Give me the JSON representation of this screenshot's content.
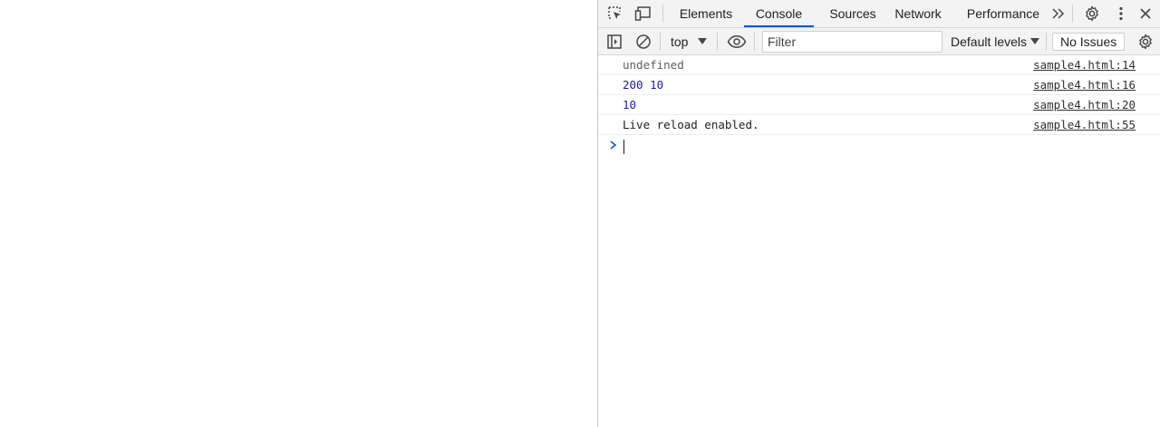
{
  "devtools": {
    "tabs": [
      {
        "label": "Elements",
        "active": false
      },
      {
        "label": "Console",
        "active": true
      },
      {
        "label": "Sources",
        "active": false
      },
      {
        "label": "Network",
        "active": false
      },
      {
        "label": "Performance",
        "active": false
      }
    ],
    "icons": {
      "inspect": "inspect-element-icon",
      "device": "device-toolbar-icon",
      "more_tabs": "chevron-double-right-icon",
      "settings": "gear-icon",
      "menu": "kebab-menu-icon",
      "close": "close-icon"
    },
    "accent_color": "#0b57d0"
  },
  "console_toolbar": {
    "context": "top",
    "filter_placeholder": "Filter",
    "filter_value": "",
    "levels_label": "Default levels",
    "issues_label": "No Issues"
  },
  "messages": [
    {
      "text": "undefined",
      "source": "sample4.html:14",
      "kind": "undefined"
    },
    {
      "text": "200 10",
      "source": "sample4.html:16",
      "kind": "number"
    },
    {
      "text": "10",
      "source": "sample4.html:20",
      "kind": "number"
    },
    {
      "text": "Live reload enabled.",
      "source": "sample4.html:55",
      "kind": "text"
    }
  ],
  "prompt": {
    "value": ""
  }
}
